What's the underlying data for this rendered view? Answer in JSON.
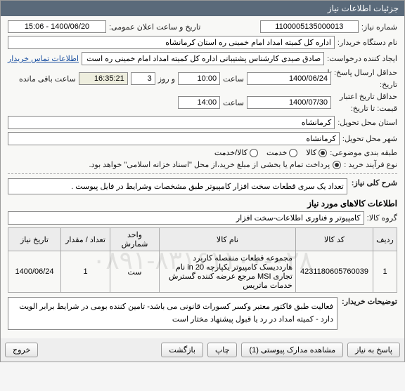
{
  "header": {
    "title": "جزئیات اطلاعات نیاز"
  },
  "fields": {
    "need_no_label": "شماره نیاز:",
    "need_no": "1100005135000013",
    "announce_label": "تاریخ و ساعت اعلان عمومی:",
    "announce": "1400/06/20 - 15:06",
    "buyer_label": "نام دستگاه خریدار:",
    "buyer": "اداره کل کمیته امداد امام خمینی ره استان کرمانشاه",
    "requester_label": "ایجاد کننده درخواست:",
    "requester": "صادق صیدی کارشناس پشتیبانی اداره کل کمیته امداد امام خمینی ره است",
    "contact_link": "اطلاعات تماس خریدار",
    "deadline_label_a": "حداقل ارسال پاسخ: تا",
    "deadline_label_b": "تاریخ:",
    "deadline_date": "1400/06/24",
    "deadline_time_label": "ساعت",
    "deadline_time": "10:00",
    "days_label": "و روز",
    "days": "3",
    "remain_label": "ساعت باقی مانده",
    "remain": "16:35:21",
    "valid_label_a": "حداقل تاریخ اعتبار",
    "valid_label_b": "قیمت: تا تاریخ:",
    "valid_date": "1400/07/30",
    "valid_time_label": "ساعت",
    "valid_time": "14:00",
    "city_req_label": "استان محل تحویل:",
    "city_req": "کرمانشاه",
    "city_deliv_label": "شهر محل تحویل:",
    "city_deliv": "کرمانشاه",
    "cat_label": "طبقه بندی موضوعی:",
    "cat_options": {
      "goods": "کالا",
      "service": "خدمت",
      "both": "کالا/خدمت"
    },
    "buy_proc_label": "نوع فرآیند خرید :",
    "buy_proc_text": "پرداخت تمام یا بخشی از مبلغ خرید،از محل \"اسناد خزانه اسلامی\" خواهد بود.",
    "summary_label": "شرح کلی نیاز:",
    "summary": "تعداد یک سری قطعات سخت افزار کامپیوتر طبق مشخصات وشرایط در فایل پیوست .",
    "goods_section": "اطلاعات کالاهای مورد نیاز",
    "group_label": "گروه کالا:",
    "group": "کامپیوتر و فناوری اطلاعات-سخت افزار",
    "table": {
      "headers": {
        "row": "ردیف",
        "code": "کد کالا",
        "name": "نام کالا",
        "unit": "واحد شمارش",
        "qty": "تعداد / مقدار",
        "date": "تاریخ نیاز"
      },
      "rows": [
        {
          "row": "1",
          "code": "4231180605760039",
          "name": "مجموعه قطعات منفصله کاربرد هارددیسک کامپیوتر یکپارچه in 20 نام تجاری MSI مرجع عرضه کننده گسترش خدمات ماتریس",
          "unit": "ست",
          "qty": "1",
          "date": "1400/06/24"
        }
      ]
    },
    "explain_label": "توضیحات خریدار:",
    "explain": "فعالیت طبق فاکتور معتبر وکسر کسورات قانونی می باشد- تامین کننده بومی در شرایط برابر الویت دارد - کمیته امداد در رد یا قبول پیشنهاد مختار است",
    "watermark": "۰۸۹۱-۸۳۱۶۱۱۰۰-۰۲۸"
  },
  "buttons": {
    "reply": "پاسخ به نیاز",
    "attachments": "مشاهده مدارک پیوستی (1)",
    "print": "چاپ",
    "back": "بازگشت",
    "exit": "خروج"
  }
}
